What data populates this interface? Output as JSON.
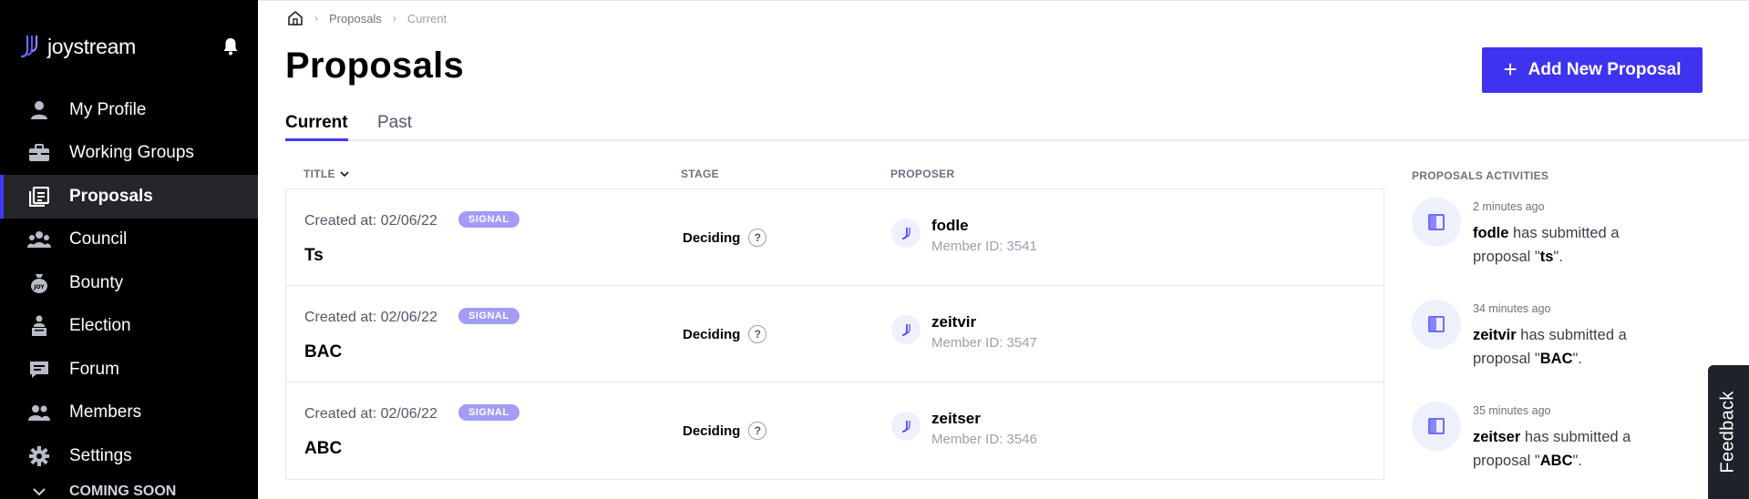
{
  "brand": {
    "name": "joystream"
  },
  "sidebar": {
    "items": [
      {
        "label": "My Profile",
        "icon": "user-icon"
      },
      {
        "label": "Working Groups",
        "icon": "briefcase-icon"
      },
      {
        "label": "Proposals",
        "icon": "proposals-icon",
        "active": true
      },
      {
        "label": "Council",
        "icon": "council-icon"
      },
      {
        "label": "Bounty",
        "icon": "bounty-icon"
      },
      {
        "label": "Election",
        "icon": "election-icon"
      },
      {
        "label": "Forum",
        "icon": "forum-icon"
      },
      {
        "label": "Members",
        "icon": "members-icon"
      },
      {
        "label": "Settings",
        "icon": "gear-icon"
      }
    ],
    "coming_soon": "COMING SOON"
  },
  "breadcrumb": {
    "items": [
      "Proposals",
      "Current"
    ]
  },
  "page": {
    "title": "Proposals",
    "add_button": "Add New Proposal"
  },
  "tabs": [
    {
      "label": "Current",
      "active": true
    },
    {
      "label": "Past",
      "active": false
    }
  ],
  "table": {
    "columns": {
      "title": "TITLE",
      "stage": "STAGE",
      "proposer": "PROPOSER"
    },
    "rows": [
      {
        "created": "Created at: 02/06/22",
        "badge": "SIGNAL",
        "title": "Ts",
        "stage": "Deciding",
        "proposer": "fodle",
        "member_id": "Member ID: 3541"
      },
      {
        "created": "Created at: 02/06/22",
        "badge": "SIGNAL",
        "title": "BAC",
        "stage": "Deciding",
        "proposer": "zeitvir",
        "member_id": "Member ID: 3547"
      },
      {
        "created": "Created at: 02/06/22",
        "badge": "SIGNAL",
        "title": "ABC",
        "stage": "Deciding",
        "proposer": "zeitser",
        "member_id": "Member ID: 3546"
      }
    ]
  },
  "activities": {
    "title": "PROPOSALS ACTIVITIES",
    "items": [
      {
        "time": "2 minutes ago",
        "member": "fodle",
        "text_mid": " has submitted a proposal \"",
        "proposal": "ts",
        "text_end": "\"."
      },
      {
        "time": "34 minutes ago",
        "member": "zeitvir",
        "text_mid": " has submitted a proposal \"",
        "proposal": "BAC",
        "text_end": "\"."
      },
      {
        "time": "35 minutes ago",
        "member": "zeitser",
        "text_mid": " has submitted a proposal \"",
        "proposal": "ABC",
        "text_end": "\"."
      }
    ]
  },
  "feedback": "Feedback",
  "colors": {
    "accent": "#4038ff",
    "button": "#3f33f0",
    "badge": "#a39cf5",
    "sidebar_bg": "#000000"
  }
}
